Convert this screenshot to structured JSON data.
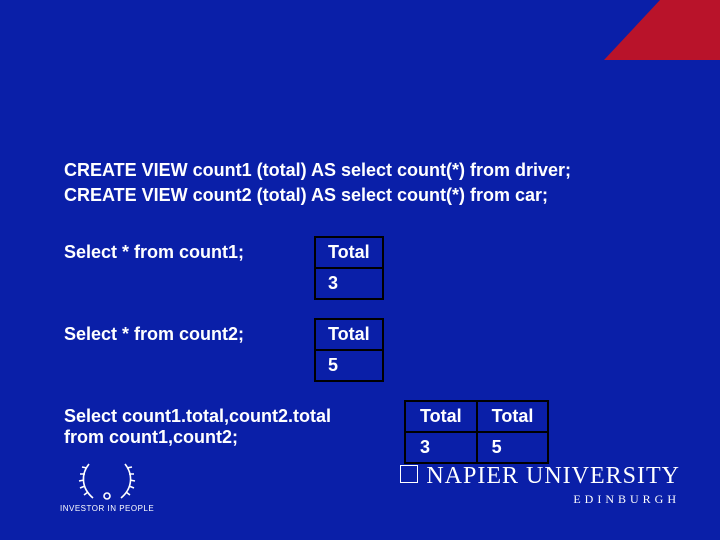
{
  "sql": {
    "create1": "CREATE VIEW count1 (total) AS select count(*) from driver;",
    "create2": "CREATE VIEW count2 (total) AS select count(*) from car;",
    "select1": "Select * from count1;",
    "select2": "Select * from count2;",
    "select3a": "Select count1.total,count2.total",
    "select3b": "from count1,count2;"
  },
  "result1": {
    "header": "Total",
    "value": "3"
  },
  "result2": {
    "header": "Total",
    "value": "5"
  },
  "result3": {
    "h1": "Total",
    "h2": "Total",
    "v1": "3",
    "v2": "5"
  },
  "footer": {
    "iip": "INVESTOR IN PEOPLE",
    "napier_main": "NAPIER UNIVERSITY",
    "napier_sub": "EDINBURGH"
  }
}
